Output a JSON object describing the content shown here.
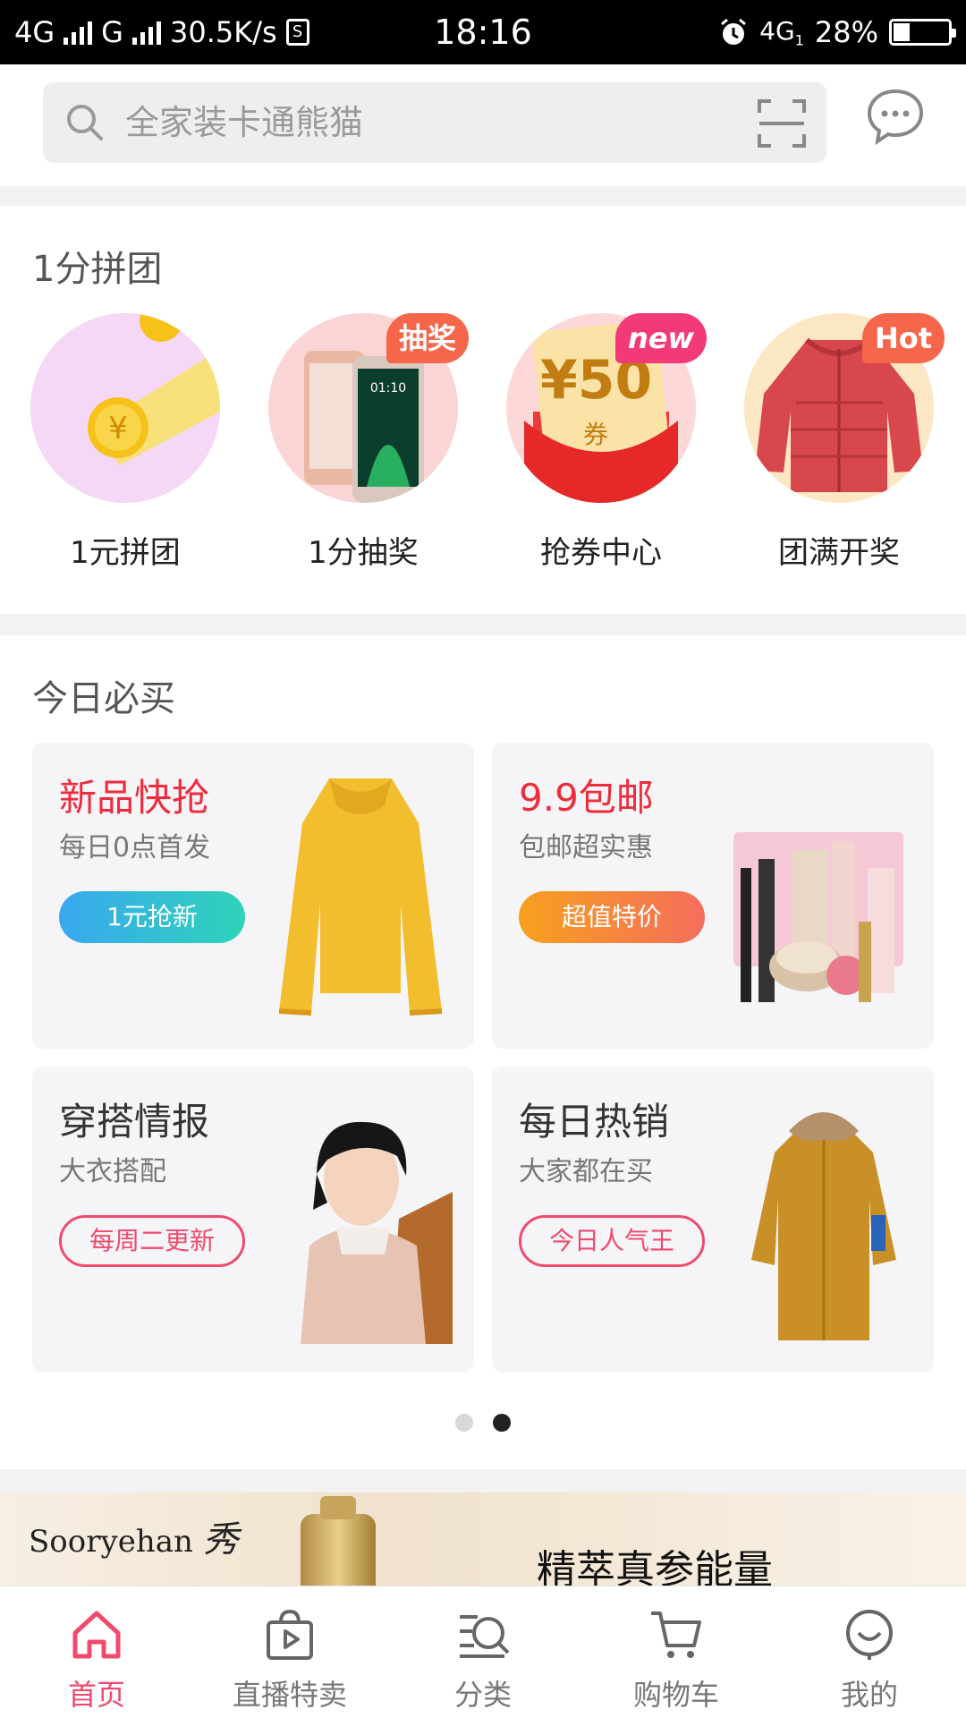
{
  "status_bar": {
    "network_left": "4G",
    "network_g": "G",
    "speed": "30.5K/s",
    "time": "18:16",
    "network_right": "4G",
    "network_right_sub": "1",
    "battery": "28%",
    "battery_level": 0.28
  },
  "search": {
    "placeholder": "全家装卡通熊猫"
  },
  "group_section": {
    "title": "1分拼团",
    "items": [
      {
        "label": "1元拼团",
        "icon": "coin-icon",
        "badge": ""
      },
      {
        "label": "1分抽奖",
        "icon": "phone-image",
        "badge": "抽奖"
      },
      {
        "label": "抢券中心",
        "icon": "coupon-image",
        "badge": "new",
        "coupon_text": "¥50",
        "coupon_sub": "券"
      },
      {
        "label": "团满开奖",
        "icon": "jacket-image",
        "badge": "Hot"
      }
    ]
  },
  "daily_section": {
    "title": "今日必买",
    "cards": [
      {
        "title": "新品快抢",
        "subtitle": "每日0点首发",
        "button": "1元抢新",
        "image": "sweater-image"
      },
      {
        "title": "9.9包邮",
        "subtitle": "包邮超实惠",
        "button": "超值特价",
        "image": "cosmetics-image"
      },
      {
        "title": "穿搭情报",
        "subtitle": "大衣搭配",
        "button": "每周二更新",
        "image": "model-image"
      },
      {
        "title": "每日热销",
        "subtitle": "大家都在买",
        "button": "今日人气王",
        "image": "parka-image"
      }
    ],
    "page_indicator": {
      "total": 2,
      "active": 2
    }
  },
  "banner": {
    "brand": "Sooryehan",
    "brand_mark": "秀",
    "headline": "精萃真参能量"
  },
  "tabbar": {
    "tabs": [
      {
        "label": "首页",
        "icon": "home-icon",
        "active": true
      },
      {
        "label": "直播特卖",
        "icon": "live-bag-icon",
        "active": false
      },
      {
        "label": "分类",
        "icon": "category-search-icon",
        "active": false
      },
      {
        "label": "购物车",
        "icon": "cart-icon",
        "active": false
      },
      {
        "label": "我的",
        "icon": "profile-icon",
        "active": false
      }
    ]
  },
  "colors": {
    "accent": "#f04a6e",
    "red_title": "#ee2c3c",
    "cyan_gradient": [
      "#3aa8f0",
      "#2ed3b8"
    ],
    "orange_gradient": [
      "#f6a11e",
      "#f56d5c"
    ],
    "pink_outline": "#f04a6e"
  }
}
